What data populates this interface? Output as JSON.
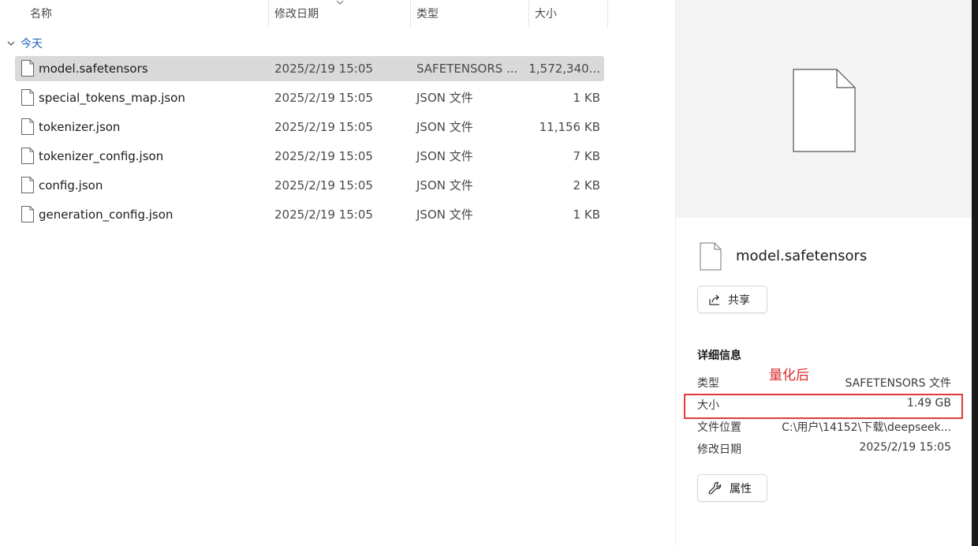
{
  "columns": {
    "name": "名称",
    "date": "修改日期",
    "type": "类型",
    "size": "大小"
  },
  "group": {
    "label": "今天"
  },
  "files": [
    {
      "name": "model.safetensors",
      "date": "2025/2/19 15:05",
      "type": "SAFETENSORS ...",
      "size": "1,572,340...",
      "selected": true
    },
    {
      "name": "special_tokens_map.json",
      "date": "2025/2/19 15:05",
      "type": "JSON 文件",
      "size": "1 KB"
    },
    {
      "name": "tokenizer.json",
      "date": "2025/2/19 15:05",
      "type": "JSON 文件",
      "size": "11,156 KB"
    },
    {
      "name": "tokenizer_config.json",
      "date": "2025/2/19 15:05",
      "type": "JSON 文件",
      "size": "7 KB"
    },
    {
      "name": "config.json",
      "date": "2025/2/19 15:05",
      "type": "JSON 文件",
      "size": "2 KB"
    },
    {
      "name": "generation_config.json",
      "date": "2025/2/19 15:05",
      "type": "JSON 文件",
      "size": "1 KB"
    }
  ],
  "details": {
    "title": "model.safetensors",
    "share_label": "共享",
    "section_label": "详细信息",
    "annotation": "量化后",
    "props": [
      {
        "key": "类型",
        "value": "SAFETENSORS 文件"
      },
      {
        "key": "大小",
        "value": "1.49 GB"
      },
      {
        "key": "文件位置",
        "value": "C:\\用户\\14152\\下载\\deepseek..."
      },
      {
        "key": "修改日期",
        "value": "2025/2/19 15:05"
      }
    ],
    "properties_label": "属性"
  },
  "colors": {
    "group_text": "#1a5fb4",
    "selected_row": "#d9d9d9",
    "annotation": "#d92b2b",
    "preview_bg": "#f3f3f3"
  }
}
